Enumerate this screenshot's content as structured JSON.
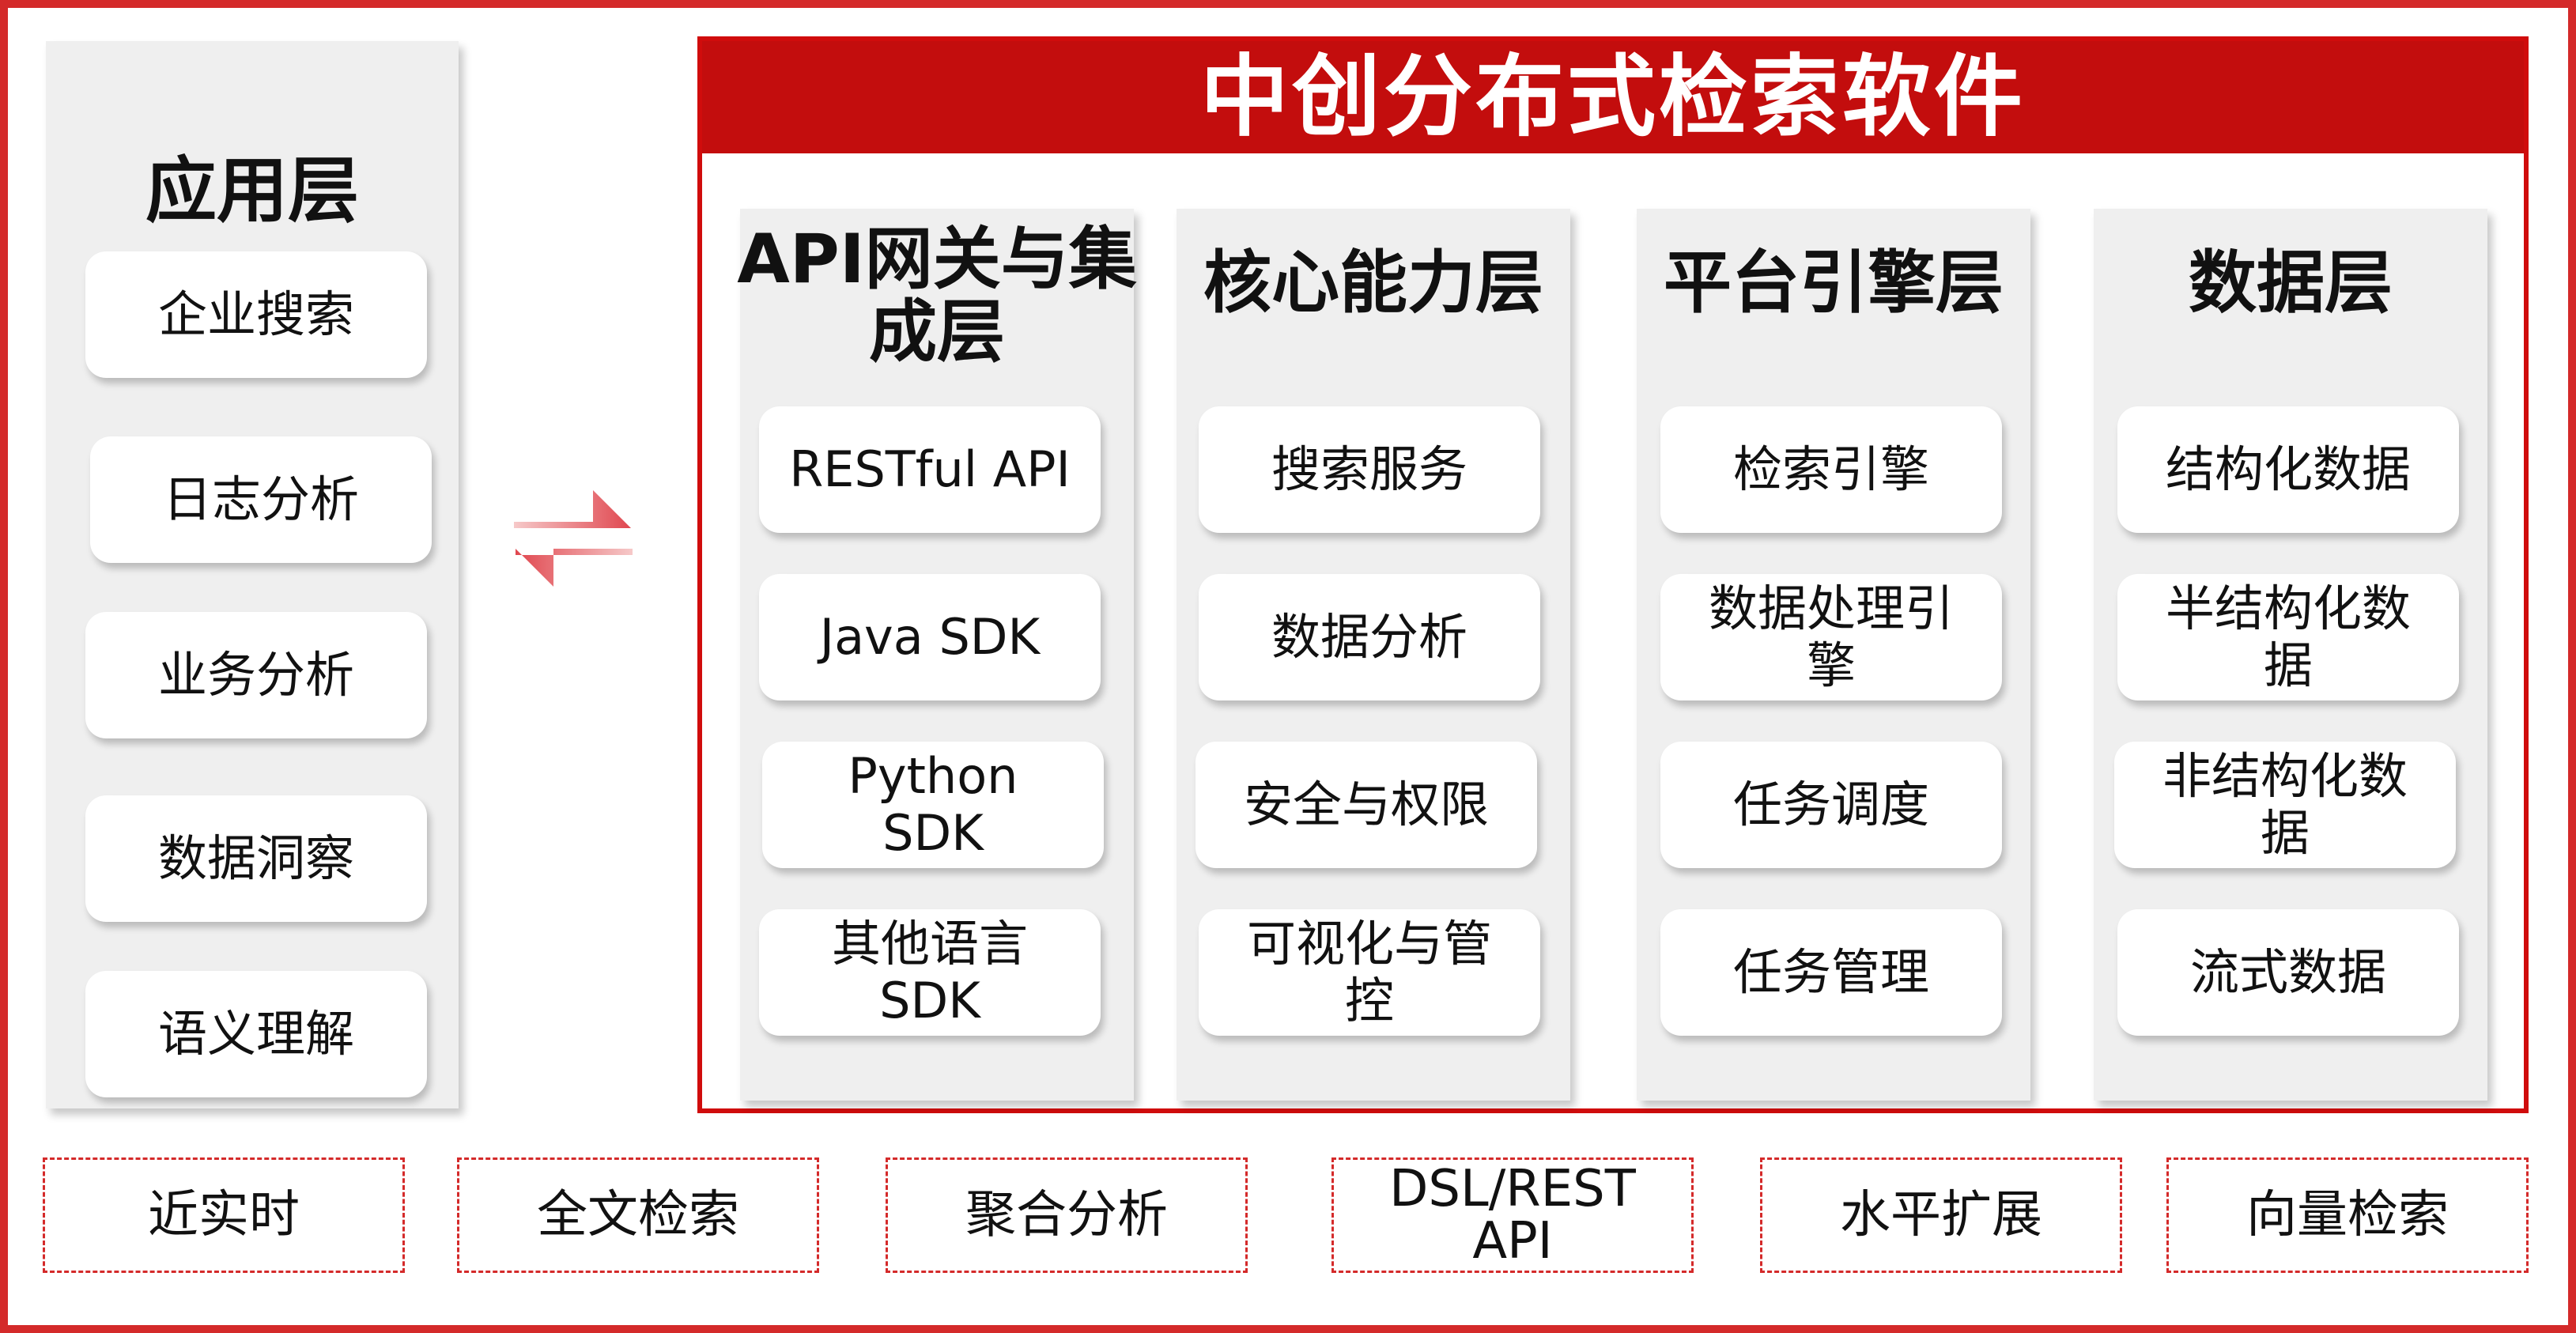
{
  "application_layer": {
    "title": "应用层",
    "items": [
      "企业搜索",
      "日志分析",
      "业务分析",
      "数据洞察",
      "语义理解"
    ]
  },
  "main_panel": {
    "title": "中创分布式检索软件",
    "layers": [
      {
        "title": "API网关与集成层",
        "items": [
          "RESTful API",
          "Java SDK",
          "Python SDK",
          "其他语言SDK"
        ]
      },
      {
        "title": "核心能力层",
        "items": [
          "搜索服务",
          "数据分析",
          "安全与权限",
          "可视化与管控"
        ]
      },
      {
        "title": "平台引擎层",
        "items": [
          "检索引擎",
          "数据处理引擎",
          "任务调度",
          "任务管理"
        ]
      },
      {
        "title": "数据层",
        "items": [
          "结构化数据",
          "半结构化数据",
          "非结构化数据",
          "流式数据"
        ]
      }
    ]
  },
  "features": [
    "近实时",
    "全文检索",
    "聚合分析",
    "DSL/REST API",
    "水平扩展",
    "向量检索"
  ],
  "colors": {
    "accent": "#c30d0d",
    "border": "#d42a2a",
    "card": "#efefef"
  },
  "icons": {
    "connector": "bidirectional-arrow-icon"
  }
}
